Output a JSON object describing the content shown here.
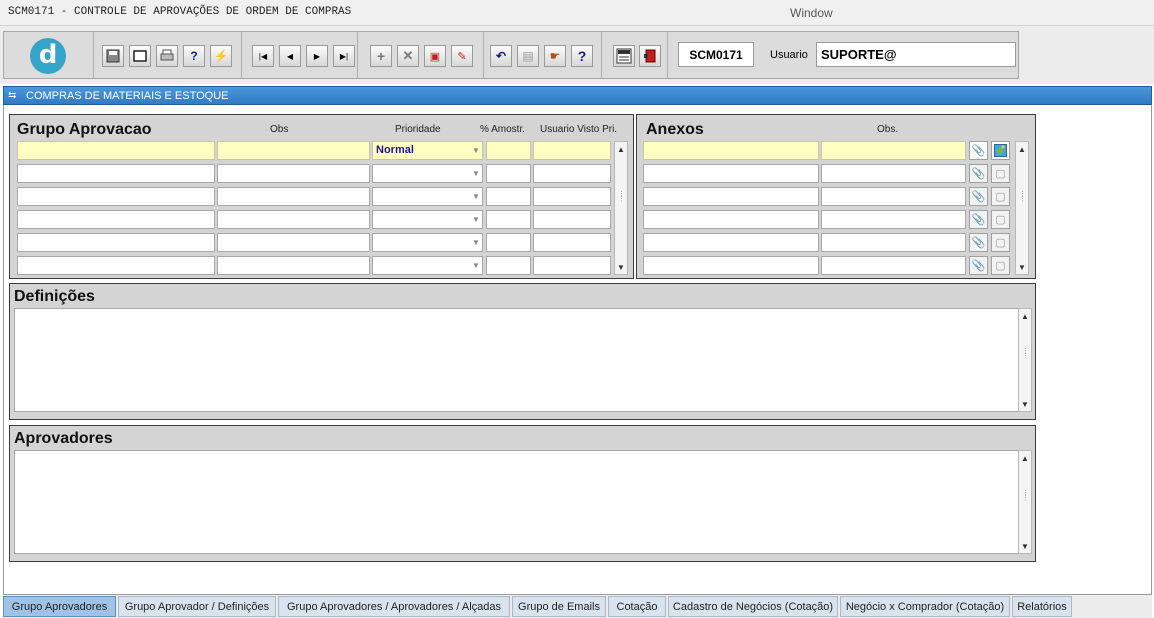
{
  "window": {
    "app_title": "SCM0171 - CONTROLE DE APROVAÇÕES DE ORDEM DE COMPRAS",
    "window_title": "Window"
  },
  "toolbar": {
    "logo_letter": "d",
    "form_code": "SCM0171",
    "user_label": "Usuario",
    "user_value": "SUPORTE@",
    "buttons": [
      {
        "name": "save-icon"
      },
      {
        "name": "window-icon"
      },
      {
        "name": "print-icon"
      },
      {
        "name": "query-help-icon"
      },
      {
        "name": "execute-query-icon"
      },
      {
        "name": "first-record-icon"
      },
      {
        "name": "prev-record-icon"
      },
      {
        "name": "next-record-icon"
      },
      {
        "name": "last-record-icon"
      },
      {
        "name": "insert-record-icon"
      },
      {
        "name": "delete-record-icon"
      },
      {
        "name": "duplicate-record-icon"
      },
      {
        "name": "edit-record-icon"
      },
      {
        "name": "undo-icon"
      },
      {
        "name": "clipboard-icon"
      },
      {
        "name": "tools-icon"
      },
      {
        "name": "help-icon"
      },
      {
        "name": "menu-icon"
      },
      {
        "name": "exit-icon"
      }
    ]
  },
  "section": {
    "title": "COMPRAS DE MATERIAIS E ESTOQUE"
  },
  "grupo_aprovacao": {
    "title": "Grupo Aprovacao",
    "columns": {
      "obs": "Obs",
      "prioridade": "Prioridade",
      "amostr": "% Amostr.",
      "usuario_visto": "Usuario Visto Pri."
    },
    "rows": [
      {
        "grupo": "",
        "obs": "",
        "prioridade": "Normal",
        "amostr": "",
        "usuario": ""
      },
      {
        "grupo": "",
        "obs": "",
        "prioridade": "",
        "amostr": "",
        "usuario": ""
      },
      {
        "grupo": "",
        "obs": "",
        "prioridade": "",
        "amostr": "",
        "usuario": ""
      },
      {
        "grupo": "",
        "obs": "",
        "prioridade": "",
        "amostr": "",
        "usuario": ""
      },
      {
        "grupo": "",
        "obs": "",
        "prioridade": "",
        "amostr": "",
        "usuario": ""
      },
      {
        "grupo": "",
        "obs": "",
        "prioridade": "",
        "amostr": "",
        "usuario": ""
      }
    ]
  },
  "anexos": {
    "title": "Anexos",
    "obs_label": "Obs.",
    "rows": [
      {
        "anexo": "",
        "obs": ""
      },
      {
        "anexo": "",
        "obs": ""
      },
      {
        "anexo": "",
        "obs": ""
      },
      {
        "anexo": "",
        "obs": ""
      },
      {
        "anexo": "",
        "obs": ""
      },
      {
        "anexo": "",
        "obs": ""
      }
    ]
  },
  "definicoes": {
    "title": "Definições",
    "text": ""
  },
  "aprovadores": {
    "title": "Aprovadores",
    "text": ""
  },
  "tabs": [
    {
      "label": "Grupo Aprovadores",
      "active": true
    },
    {
      "label": "Grupo Aprovador / Definições",
      "active": false
    },
    {
      "label": "Grupo Aprovadores / Aprovadores / Alçadas",
      "active": false
    },
    {
      "label": "Grupo de Emails",
      "active": false
    },
    {
      "label": "Cotação",
      "active": false
    },
    {
      "label": "Cadastro de Negócios (Cotação)",
      "active": false
    },
    {
      "label": "Negócio x Comprador (Cotação)",
      "active": false
    },
    {
      "label": "Relatórios",
      "active": false
    }
  ],
  "colors": {
    "accent": "#2f7cc6",
    "required_field": "#ffffc2",
    "panel": "#d4d4d4"
  }
}
